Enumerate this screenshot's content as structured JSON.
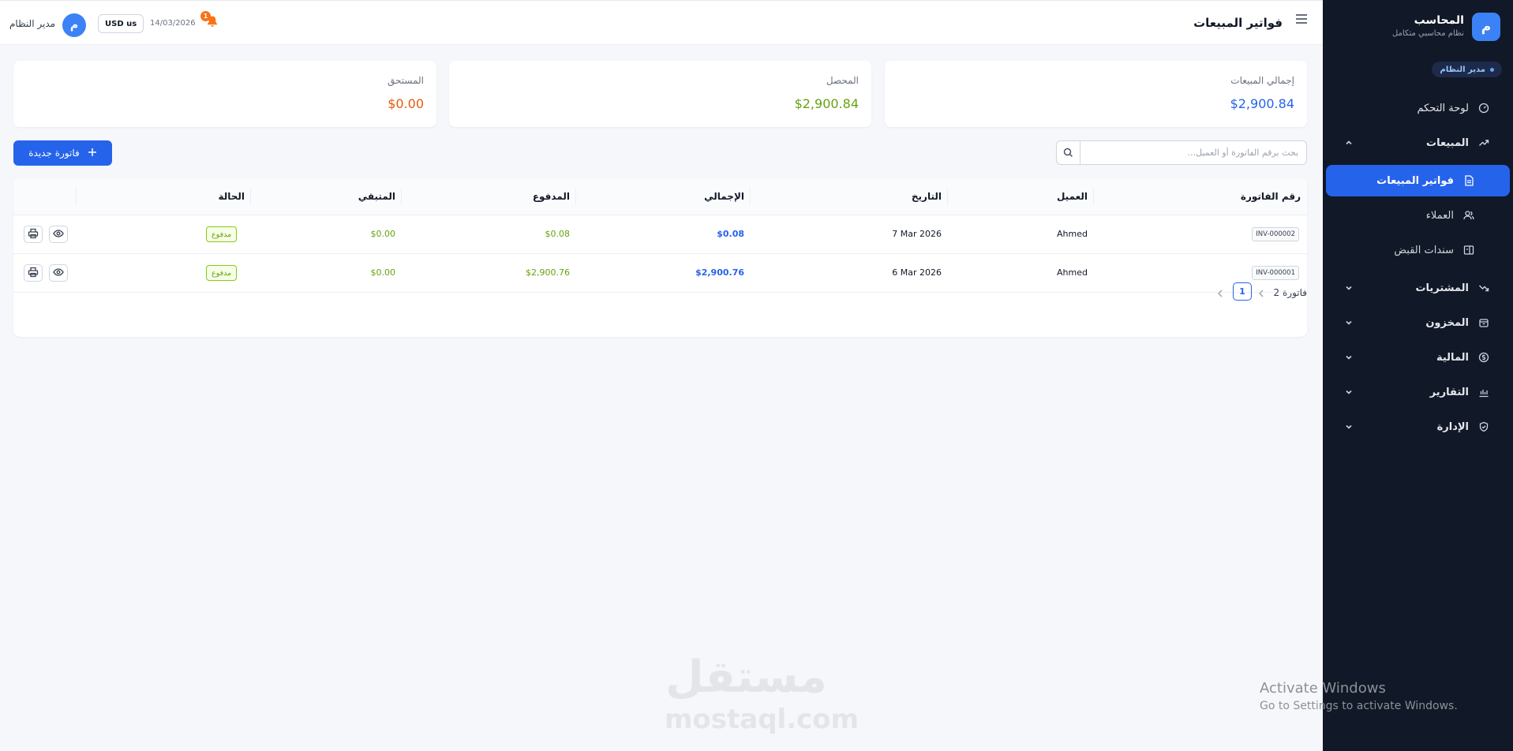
{
  "sidebar": {
    "brand_initial": "م",
    "brand_title": "المحاسب",
    "brand_subtitle": "نظام محاسبي متكامل",
    "role": "مدير النظام",
    "items": [
      {
        "label": "لوحة التحكم",
        "icon": "dashboard-icon"
      },
      {
        "label": "المبيعات",
        "icon": "trend-up-icon",
        "expanded": true
      },
      {
        "label": "فواتير المبيعات",
        "icon": "invoice-icon",
        "active": true
      },
      {
        "label": "العملاء",
        "icon": "users-icon"
      },
      {
        "label": "سندات القبض",
        "icon": "receipt-icon"
      },
      {
        "label": "المشتريات",
        "icon": "trend-down-icon"
      },
      {
        "label": "المخزون",
        "icon": "box-icon"
      },
      {
        "label": "المالية",
        "icon": "dollar-circle-icon"
      },
      {
        "label": "التقارير",
        "icon": "bar-chart-icon"
      },
      {
        "label": "الإدارة",
        "icon": "shield-icon"
      }
    ]
  },
  "topbar": {
    "title": "فواتير المبيعات",
    "user_initial": "م",
    "user_name": "مدير النظام",
    "currency": "USD us",
    "date": "14/03/2026",
    "notifications": "1"
  },
  "stats": {
    "total_sales_label": "إجمالي المبيعات",
    "total_sales_value": "$2,900.84",
    "collected_label": "المحصل",
    "collected_value": "$2,900.84",
    "due_label": "المستحق",
    "due_value": "$0.00"
  },
  "search": {
    "placeholder": "بحث برقم الفاتورة أو العميل..."
  },
  "new_invoice_label": "فاتورة جديدة",
  "table": {
    "headers": {
      "invoice_no": "رقم الفاتورة",
      "customer": "العميل",
      "date": "التاريخ",
      "total": "الإجمالي",
      "paid": "المدفوع",
      "remaining": "المتبقي",
      "status": "الحالة"
    },
    "rows": [
      {
        "invoice_no": "INV-000002",
        "customer": "Ahmed",
        "date": "7 Mar 2026",
        "total": "$0.08",
        "paid": "$0.08",
        "remaining": "$0.00",
        "status": "مدفوع"
      },
      {
        "invoice_no": "INV-000001",
        "customer": "Ahmed",
        "date": "6 Mar 2026",
        "total": "$2,900.76",
        "paid": "$2,900.76",
        "remaining": "$0.00",
        "status": "مدفوع"
      }
    ]
  },
  "pagination": {
    "summary": "2 فاتورة",
    "current_page": "1"
  },
  "watermark": {
    "logo": "مستقل",
    "text": "mostaql.com"
  },
  "os_notice": {
    "line1": "Activate Windows",
    "line2": "Go to Settings to activate Windows."
  },
  "colors": {
    "sidebar_bg": "#111827",
    "accent": "#2563eb",
    "blue_value": "#2563eb",
    "green_value": "#65a30d",
    "orange_value": "#ea580c"
  }
}
